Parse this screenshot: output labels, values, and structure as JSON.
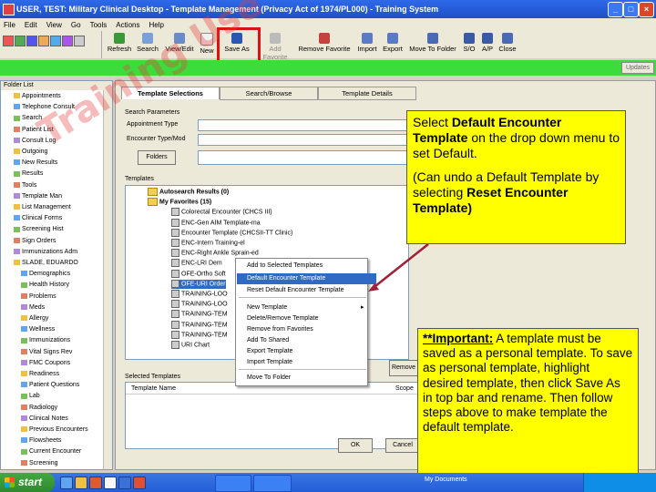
{
  "window": {
    "title": "USER, TEST: Military Clinical Desktop - Template Management (Privacy Act of 1974/PL000) - Training System",
    "controls": [
      "_",
      "□",
      "×"
    ]
  },
  "menubar": [
    "File",
    "Edit",
    "View",
    "Go",
    "Tools",
    "Actions",
    "Help"
  ],
  "toolbar": [
    {
      "label": "Refresh",
      "icon": "refresh-icon"
    },
    {
      "label": "Search",
      "icon": "search-icon"
    },
    {
      "label": "View/Edit",
      "icon": "view-edit-icon"
    },
    {
      "label": "New",
      "icon": "new-icon"
    },
    {
      "label": "Save As",
      "icon": "save-icon"
    },
    {
      "label": "Add Favorite",
      "icon": "add-favorite-icon"
    },
    {
      "label": "Remove Favorite",
      "icon": "remove-favorite-icon"
    },
    {
      "label": "Import",
      "icon": "import-icon"
    },
    {
      "label": "Export",
      "icon": "export-icon"
    },
    {
      "label": "Move To Folder",
      "icon": "move-folder-icon"
    },
    {
      "label": "S/O",
      "icon": "so-icon"
    },
    {
      "label": "A/P",
      "icon": "ap-icon"
    },
    {
      "label": "Close",
      "icon": "close-icon"
    }
  ],
  "greenbar": {
    "updates": "Updates"
  },
  "folder_list": {
    "header": "Folder List",
    "items": [
      "Appointments",
      "Telephone Consult",
      "Search",
      "Patient List",
      "Consult Log",
      "Outgoing",
      "New Results",
      "Results",
      "Tools",
      "Template Man",
      "List Management",
      "Clinical Forms",
      "Screening Hist",
      "Sign Orders",
      "Immunizations Adm",
      "SLADE, EDUARDO",
      "Demographics",
      "Health History",
      "Problems",
      "Meds",
      "Allergy",
      "Wellness",
      "Immunizations",
      "Vital Signs Rev",
      "FMC Coupons",
      "Readiness",
      "Patient Questions",
      "Lab",
      "Radiology",
      "Clinical Notes",
      "Previous Encounters",
      "Flowsheets",
      "Current Encounter",
      "Screening"
    ]
  },
  "tabs": [
    "Template Selections",
    "Search/Browse",
    "Template Details"
  ],
  "search_params": {
    "label": "Search Parameters",
    "appointment_type": "Appointment Type",
    "encounter_type": "Encounter Type/Mod",
    "folders_button": "Folders"
  },
  "templates": {
    "label": "Templates",
    "rows": [
      "Autosearch Results (0)",
      "My Favorites (15)",
      "Colorectal Encounter (CHCS III)",
      "ENC-Gen AIM Template-ma",
      "Encounter Template (CHCSII-TT Clinic)",
      "ENC-Intern Training-el",
      "ENC-Right Ankle Sprain-ed",
      "ENC-LRI Dem",
      "OFE-Ortho Soft",
      "OFE-URI Order",
      "TRAINING-LOO",
      "TRAINING-LOO",
      "TRAINING-TEM",
      "TRAINING-TEM",
      "TRAINING-TEM",
      "URI Chart"
    ]
  },
  "context_menu": {
    "items": [
      "Add to Selected Templates",
      "Default Encounter Template",
      "Reset Default Encounter Template",
      "New Template",
      "Delete/Remove Template",
      "Remove from Favorites",
      "Add To Shared",
      "Export Template",
      "Import Template",
      "Move To Folder"
    ],
    "highlighted_index": 1
  },
  "selected_templates": {
    "label": "Selected Templates",
    "column_name": "Template Name",
    "column_scope": "Scope"
  },
  "buttons": {
    "ok": "OK",
    "cancel": "Cancel",
    "remove": "Remove"
  },
  "callout_1": {
    "p1_pre": "Select ",
    "p1_bold": "Default Encounter Template",
    "p1_post": " on the drop down menu to set Default.",
    "p2_pre": "(Can undo a Default Template by selecting ",
    "p2_bold": "Reset Encounter Template)"
  },
  "callout_2": {
    "important": "**Important:",
    "text": " A template must be saved as a personal template. To save as personal template, highlight desired template, then click Save As in top bar and rename. Then follow steps above to make template the default template."
  },
  "taskbar": {
    "start": "start",
    "my_documents": "My Documents"
  },
  "watermark": "Training Use Only",
  "colors": {
    "titlebar": "#2456d6",
    "greenbar": "#3cdc3c",
    "callout": "#ffff00",
    "highlight": "#316ac5",
    "save_box": "#e01010"
  }
}
